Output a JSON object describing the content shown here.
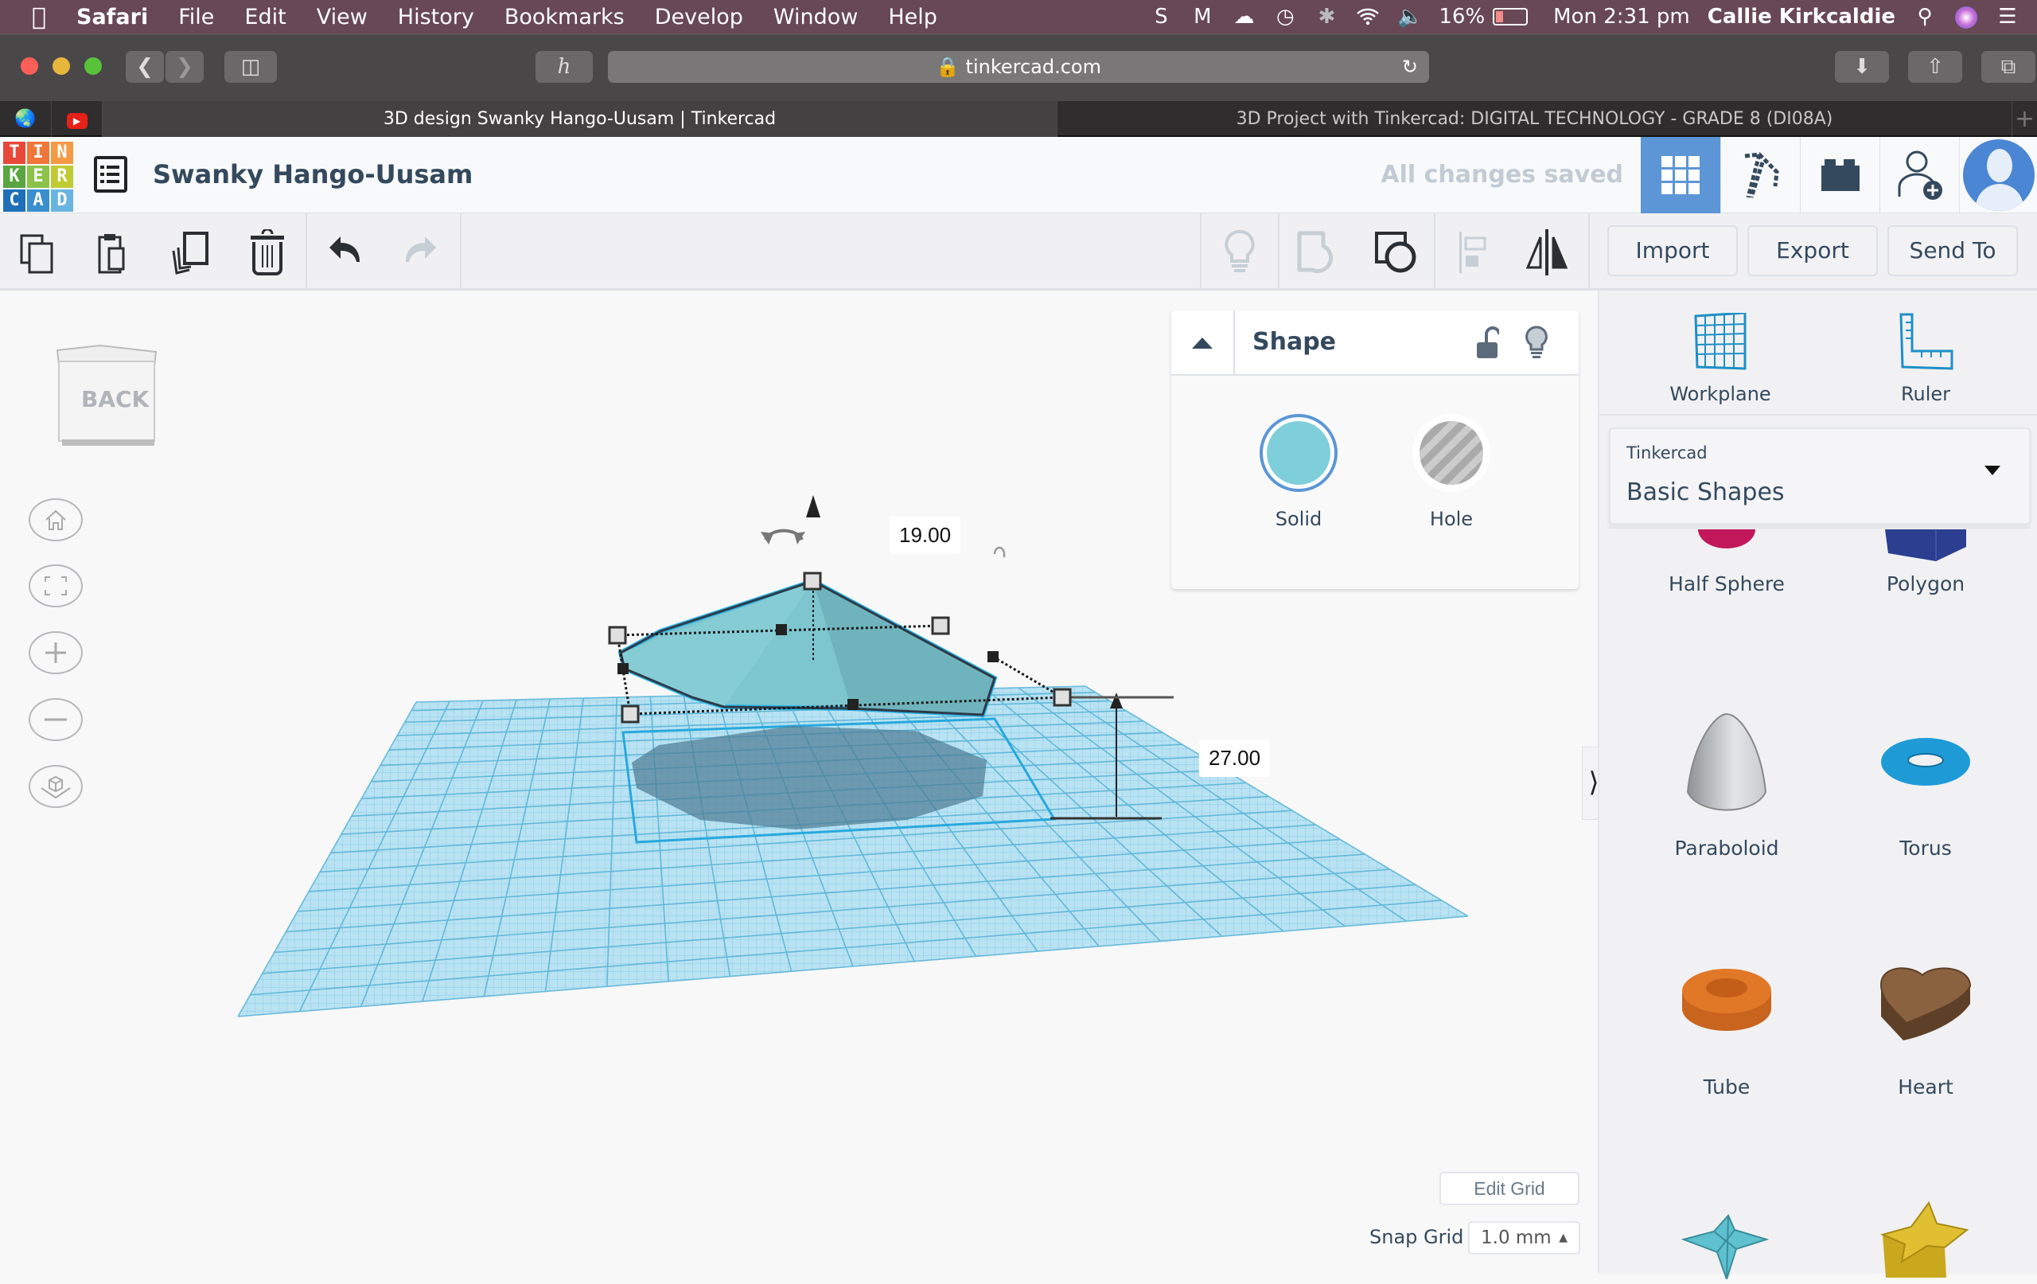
{
  "menubar": {
    "apple": "",
    "items": [
      "Safari",
      "File",
      "Edit",
      "View",
      "History",
      "Bookmarks",
      "Develop",
      "Window",
      "Help"
    ],
    "status": {
      "battery": "16%",
      "clock": "Mon 2:31 pm",
      "user": "Callie Kirkcaldie"
    }
  },
  "safari": {
    "url": "tinkercad.com",
    "tabs": [
      {
        "title": "3D design Swanky Hango-Uusam | Tinkercad",
        "active": true
      },
      {
        "title": "3D Project with Tinkercad: DIGITAL TECHNOLOGY - GRADE 8 (DI08A)",
        "active": false
      }
    ],
    "new_tab": "+"
  },
  "header": {
    "logo": [
      "T",
      "I",
      "N",
      "K",
      "E",
      "R",
      "C",
      "A",
      "D"
    ],
    "logo_colors": [
      "#e8473a",
      "#f0763a",
      "#f59a44",
      "#6aa84f",
      "#8bc34a",
      "#c0ca33",
      "#1e6fb7",
      "#3a8fcf",
      "#6ab4e0"
    ],
    "design_name": "Swanky Hango-Uusam",
    "save_status": "All changes saved",
    "accent": "#5c96d6"
  },
  "toolbar": {
    "left_icons": [
      "copy-icon",
      "paste-icon",
      "duplicate-icon",
      "delete-icon",
      "undo-icon",
      "redo-icon"
    ],
    "right_icons": [
      "note-icon",
      "group-icon",
      "ungroup-icon",
      "align-icon",
      "mirror-icon"
    ],
    "import_label": "Import",
    "export_label": "Export",
    "send_to_label": "Send To"
  },
  "viewcube": {
    "label": "BACK"
  },
  "shape_panel": {
    "title": "Shape",
    "solid_label": "Solid",
    "hole_label": "Hole",
    "solid_color": "#7ecfd9",
    "selected": "Solid"
  },
  "dimensions": {
    "height_label": "19.00",
    "elevation_label": "27.00"
  },
  "right_panel": {
    "workplane_label": "Workplane",
    "ruler_label": "Ruler",
    "library_source": "Tinkercad",
    "library_name": "Basic Shapes",
    "shapes": [
      {
        "name": "Half Sphere",
        "color": "#c2185b"
      },
      {
        "name": "Polygon",
        "color": "#2c3e8f"
      },
      {
        "name": "Paraboloid",
        "color": "#d5d8da"
      },
      {
        "name": "Torus",
        "color": "#1e9bd7"
      },
      {
        "name": "Tube",
        "color": "#e07828"
      },
      {
        "name": "Heart",
        "color": "#8b6240"
      },
      {
        "name": "Star (pyramid)",
        "color": "#5fc0cf"
      },
      {
        "name": "Star",
        "color": "#e0c032"
      }
    ]
  },
  "grid": {
    "edit_grid_label": "Edit Grid",
    "snap_grid_label": "Snap Grid",
    "snap_grid_value": "1.0 mm"
  }
}
